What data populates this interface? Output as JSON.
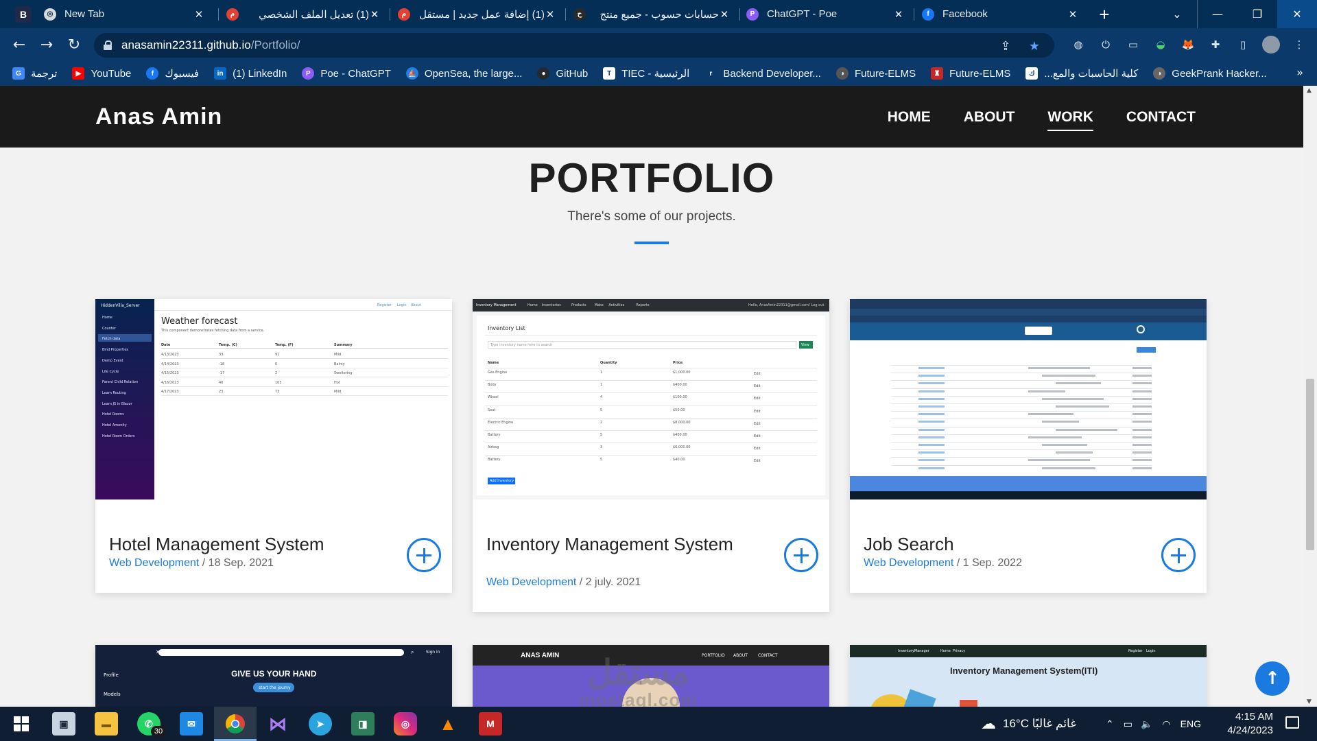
{
  "browser": {
    "app_badge": "B",
    "tabs": [
      {
        "title": "New Tab",
        "fav_color": "#d9d9d9",
        "fav": "◎"
      },
      {
        "title": "(1) تعديل الملف الشخصي",
        "fav_color": "#e34133",
        "fav": "م"
      },
      {
        "title": "(1) إضافة عمل جديد | مستقل",
        "fav_color": "#e34133",
        "fav": "م"
      },
      {
        "title": "حسابات حسوب - جميع منتج",
        "fav_color": "#2a2a2a",
        "fav": "ح"
      },
      {
        "title": "ChatGPT - Poe",
        "fav_color": "#8b5cf6",
        "fav": "P"
      },
      {
        "title": "Facebook",
        "fav_color": "#1877f2",
        "fav": "f"
      }
    ],
    "url_host": "anasamin22311.github.io",
    "url_path": "/Portfolio/",
    "bookmarks": [
      {
        "label": "ترجمة",
        "color": "#4285f4",
        "glyph": "G"
      },
      {
        "label": "YouTube",
        "color": "#ff0000",
        "glyph": "▶"
      },
      {
        "label": "فيسبوك",
        "color": "#1877f2",
        "glyph": "f"
      },
      {
        "label": "(1) LinkedIn",
        "color": "#0a66c2",
        "glyph": "in"
      },
      {
        "label": "Poe - ChatGPT",
        "color": "#8b5cf6",
        "glyph": "P"
      },
      {
        "label": "OpenSea, the large...",
        "color": "#2081e2",
        "glyph": "⛵"
      },
      {
        "label": "GitHub",
        "color": "#24292f",
        "glyph": "●"
      },
      {
        "label": "TIEC - الرئيسية",
        "color": "#ffffff",
        "glyph": "T"
      },
      {
        "label": "Backend Developer...",
        "color": "#0b3a6a",
        "glyph": "r"
      },
      {
        "label": "Future-ELMS",
        "color": "#555555",
        "glyph": "◑"
      },
      {
        "label": "Future-ELMS",
        "color": "#c62828",
        "glyph": "♜"
      },
      {
        "label": "كلية الحاسبات والمع...",
        "color": "#ffffff",
        "glyph": "ك"
      },
      {
        "label": "GeekPrank Hacker...",
        "color": "#666666",
        "glyph": "◑"
      }
    ]
  },
  "site": {
    "brand": "Anas Amin",
    "menu": [
      "HOME",
      "ABOUT",
      "WORK",
      "CONTACT"
    ],
    "active_menu": "WORK",
    "heading": "PORTFOLIO",
    "subheading": "There's some of our projects.",
    "accent_color": "#1a7ae0",
    "projects": [
      {
        "title": "Hotel Management System",
        "category": "Web Development",
        "date": " / 18 Sep. 2021",
        "thumb": {
          "brand": "HiddenVilla_Server",
          "heading": "Weather forecast",
          "caption": "This component demonstrates fetching data from a service.",
          "nav_links": [
            "Register",
            "Login",
            "About"
          ],
          "sidebar": [
            "Home",
            "Counter",
            "Fetch data",
            "Bind Properties",
            "Demo Event",
            "Life Cycle",
            "Parent Child Relation",
            "Learn Routing",
            "Learn JS in Blazor",
            "Hotel Rooms",
            "Hotel Amenity",
            "Hotel Room Orders"
          ],
          "columns": [
            "Date",
            "Temp. (C)",
            "Temp. (F)",
            "Summary"
          ],
          "rows": [
            [
              "4/13/2023",
              "33",
              "91",
              "Mild"
            ],
            [
              "4/14/2023",
              "-18",
              "0",
              "Balmy"
            ],
            [
              "4/15/2023",
              "-17",
              "2",
              "Sweltering"
            ],
            [
              "4/16/2023",
              "40",
              "103",
              "Hot"
            ],
            [
              "4/17/2023",
              "23",
              "73",
              "Mild"
            ]
          ]
        }
      },
      {
        "title": "Inventory Management System",
        "category": "Web Development",
        "date": " / 2 july. 2021",
        "thumb": {
          "brand": "Inventory Management",
          "nav_links": [
            "Home",
            "Inventories",
            "Products",
            "Make",
            "Activities",
            "Reports"
          ],
          "user": "Hello, AnasAmin22311@gmail.com!  Log out",
          "heading": "Inventory List",
          "search": "Type inventory name here to search",
          "view": "View",
          "columns": [
            "Name",
            "Quantity",
            "Price"
          ],
          "rows": [
            [
              "Gas Engine",
              "1",
              "$1,000.00"
            ],
            [
              "Body",
              "1",
              "$400.00"
            ],
            [
              "Wheel",
              "4",
              "$100.00"
            ],
            [
              "Seat",
              "5",
              "$50.00"
            ],
            [
              "Electric Engine",
              "2",
              "$8,000.00"
            ],
            [
              "Battery",
              "5",
              "$400.00"
            ],
            [
              "Airbag",
              "3",
              "$6,000.00"
            ],
            [
              "Battery",
              "5",
              "$40.00"
            ]
          ],
          "edit": "Edit",
          "add": "Add Inventory"
        }
      },
      {
        "title": "Job Search",
        "category": "Web Development",
        "date": " / 1 Sep. 2022"
      }
    ],
    "bottom_cards": [
      {
        "banner": "GIVE US YOUR HAND",
        "cta": "start the journy",
        "signin": "Sign in",
        "side": [
          "Profile",
          "Models"
        ]
      },
      {
        "brand": "ANAS AMIN",
        "links": [
          "PORTFOLIO",
          "ABOUT",
          "CONTACT"
        ]
      },
      {
        "brand": "InventoryManager",
        "links": [
          "Home",
          "Privacy"
        ],
        "right": [
          "Register",
          "Login"
        ],
        "heading": "Inventory Management System(ITI)"
      }
    ],
    "watermark_ar": "مستقل",
    "watermark_en": "mostaql.com"
  },
  "taskbar": {
    "whatsapp_badge": "30",
    "weather": "16°C  غائم غالبًا",
    "lang": "ENG",
    "time": "4:15 AM",
    "date": "4/24/2023"
  }
}
